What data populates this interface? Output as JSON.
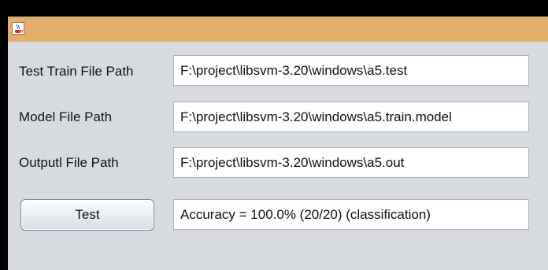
{
  "window": {
    "icon": "java-coffee-icon",
    "titlebar_color": "#e3ad6c"
  },
  "form": {
    "test_train_label": "Test Train File Path",
    "test_train_value": "F:\\project\\libsvm-3.20\\windows\\a5.test",
    "model_label": "Model File Path",
    "model_value": "F:\\project\\libsvm-3.20\\windows\\a5.train.model",
    "output_label": "Outputl File Path",
    "output_value": "F:\\project\\libsvm-3.20\\windows\\a5.out",
    "test_button_label": "Test",
    "result_value": "Accuracy = 100.0% (20/20) (classification)"
  }
}
